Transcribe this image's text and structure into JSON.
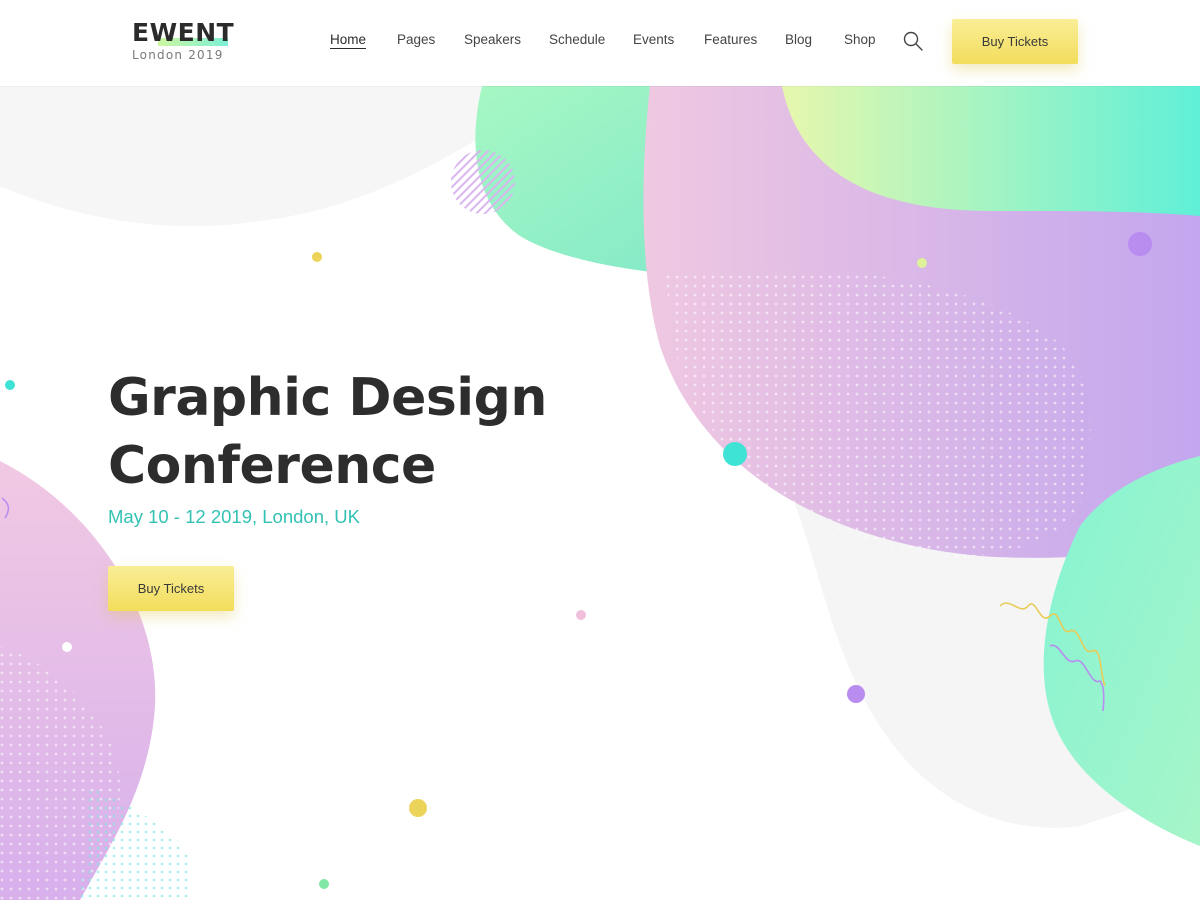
{
  "brand": {
    "name": "EWENT",
    "tagline": "London 2019"
  },
  "nav": {
    "items": [
      {
        "label": "Home",
        "active": true
      },
      {
        "label": "Pages",
        "active": false
      },
      {
        "label": "Speakers",
        "active": false
      },
      {
        "label": "Schedule",
        "active": false
      },
      {
        "label": "Events",
        "active": false
      },
      {
        "label": "Features",
        "active": false
      },
      {
        "label": "Blog",
        "active": false
      },
      {
        "label": "Shop",
        "active": false
      }
    ],
    "search_icon": "search-icon",
    "cta_label": "Buy Tickets"
  },
  "hero": {
    "title_line1": "Graphic Design",
    "title_line2": "Conference",
    "subtitle": "May 10 - 12 2019, London, UK",
    "cta_label": "Buy Tickets"
  },
  "colors": {
    "accent_teal": "#33c2b4",
    "button_yellow": "#f6e579",
    "blob_pink": "#eec7e3",
    "blob_violet": "#c8a4ef",
    "blob_mint": "#8ff2c8",
    "blob_lime": "#e2f7a9"
  }
}
